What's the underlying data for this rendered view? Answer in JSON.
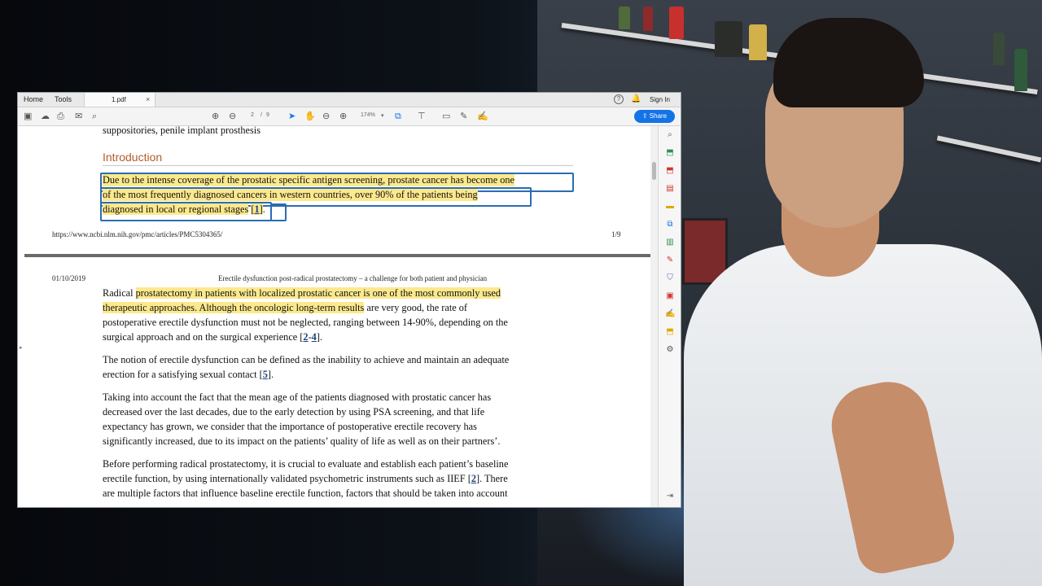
{
  "app": {
    "tabs": {
      "home": "Home",
      "tools": "Tools",
      "document": "1.pdf",
      "close": "×"
    },
    "sign_in": "Sign In",
    "help": "?",
    "share": "Share"
  },
  "toolbar": {
    "current_page": "2",
    "page_separator": "/",
    "total_pages": "9",
    "zoom": "174%"
  },
  "doc": {
    "top_line": "suppositories, penile implant prosthesis",
    "section_title": "Introduction",
    "intro": [
      "Due to the intense coverage of the prostatic specific antigen screening, prostate cancer has become one",
      "of the most frequently diagnosed cancers in western countries, over 90% of the patients being",
      "diagnosed in local or regional stages"
    ],
    "intro_ref": "1",
    "intro_end": ".",
    "footer_url": "https://www.ncbi.nlm.nih.gov/pmc/articles/PMC5304365/",
    "footer_page": "1/9",
    "header_date": "01/10/2019",
    "header_title": "Erectile dysfunction post-radical prostatectomy – a challenge for both patient and physician",
    "p1": {
      "l1_plain": "Radical ",
      "l1_hl": "prostatectomy in patients with localized prostatic cancer is one of the most commonly used",
      "l2_hl": "therapeutic approaches. Although the oncologic long-term results",
      "l2_plain": " are very good, the rate of",
      "l3": "postoperative erectile dysfunction must not be neglected, ranging between 14-90%, depending on the",
      "l4_a": "surgical approach and on the surgical experience [",
      "ref_a": "2",
      "dash": "-",
      "ref_b": "4",
      "l4_b": "]."
    },
    "p2": {
      "l1": "The notion of erectile dysfunction can be defined as the inability to achieve and maintain an adequate",
      "l2_a": "erection for a satisfying sexual contact [",
      "ref": "5",
      "l2_b": "]."
    },
    "p3": [
      "Taking into account the fact that the mean age of the patients diagnosed with prostatic cancer has",
      "decreased over the last decades, due to the early detection by using PSA screening, and that life",
      "expectancy has grown, we consider that the importance of postoperative erectile recovery has",
      "significantly increased, due to its impact on the patients’ quality of life as well as on their partners’."
    ],
    "p4": {
      "l1": "Before performing radical prostatectomy, it is crucial to evaluate and establish each patient’s baseline",
      "l2_a": "erectile function, by using internationally validated psychometric instruments such as IIEF [",
      "ref": "2",
      "l2_b": "]. There",
      "l3": "are multiple factors that influence baseline erectile function, factors that should be taken into account"
    }
  },
  "colors": {
    "highlight": "#fce98d",
    "selection": "#2b6cb3",
    "share": "#1473e6",
    "heading": "#b45c2b"
  },
  "icons": [
    "save-icon",
    "upload-icon",
    "print-icon",
    "mail-icon",
    "search-zoom-icon",
    "page-up-icon",
    "page-down-icon",
    "cursor-icon",
    "hand-icon",
    "zoom-out-icon",
    "zoom-in-icon",
    "fit-icon",
    "measure-icon",
    "comment-icon",
    "pen-icon",
    "sign-icon",
    "share-icon"
  ]
}
